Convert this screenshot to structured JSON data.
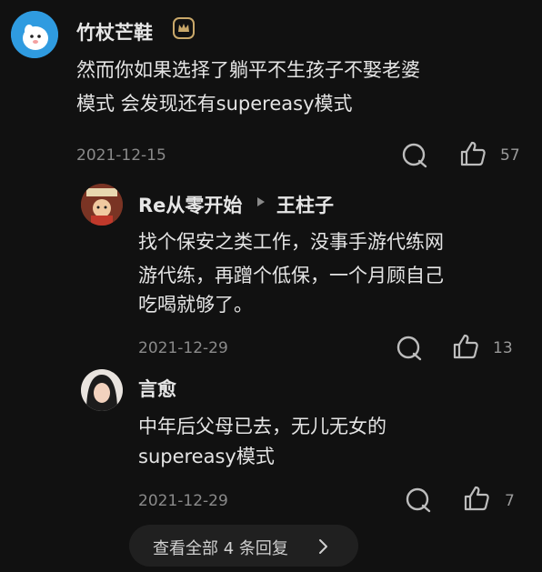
{
  "main_comment": {
    "username": "竹杖芒鞋",
    "badge_icon": "crown-badge-icon",
    "text_line1": "然而你如果选择了躺平不生孩子不娶老婆",
    "text_line2": "模式 会发现还有supereasy模式",
    "date": "2021-12-15",
    "like_count": "57"
  },
  "replies": [
    {
      "username": "Re从零开始",
      "reply_to": "王柱子",
      "text_line1": "找个保安之类工作，没事手游代练网",
      "text_line2": "游代练，再蹭个低保，一个月顾自己",
      "text_line3": "吃喝就够了。",
      "date": "2021-12-29",
      "like_count": "13"
    },
    {
      "username": "言愈",
      "text_line1": "中年后父母已去，无儿无女的",
      "text_line2": "supereasy模式",
      "date": "2021-12-29",
      "like_count": "7"
    }
  ],
  "view_all_replies": "查看全部 4 条回复",
  "colors": {
    "background": "#111111",
    "text": "#e4e4e4",
    "muted": "#8a8a8a",
    "badge": "#c9a86a"
  }
}
